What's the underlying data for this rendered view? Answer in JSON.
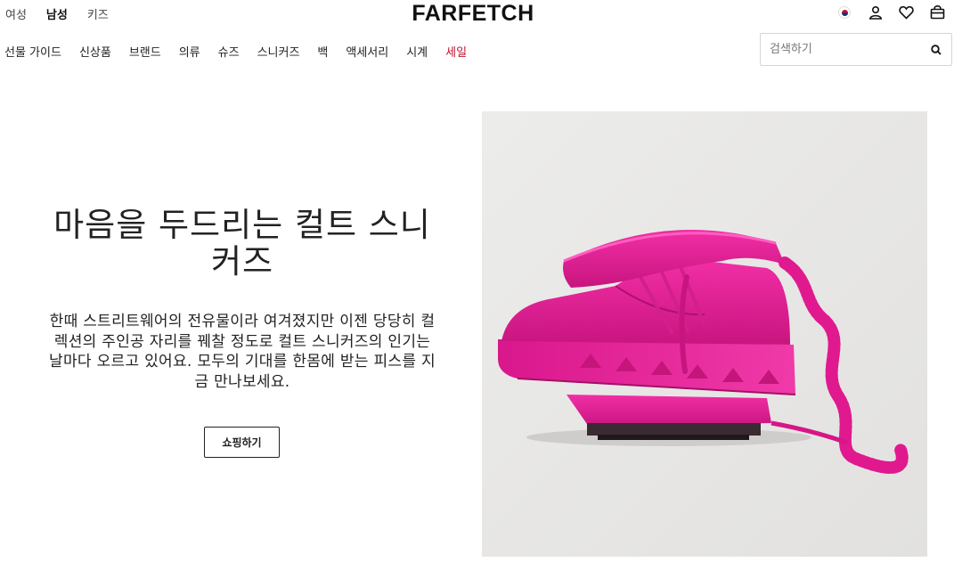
{
  "header": {
    "gender_tabs": [
      {
        "label": "여성",
        "active": false
      },
      {
        "label": "남성",
        "active": true
      },
      {
        "label": "키즈",
        "active": false
      }
    ],
    "logo": "FARFETCH",
    "icons": [
      "korea-flag-icon",
      "account-icon",
      "wishlist-heart-icon",
      "shopping-bag-icon"
    ]
  },
  "nav": {
    "items": [
      "선물 가이드",
      "신상품",
      "브랜드",
      "의류",
      "슈즈",
      "스니커즈",
      "백",
      "액세서리",
      "시계",
      "세일"
    ],
    "sale_color": "#c4122f"
  },
  "search": {
    "placeholder": "검색하기",
    "value": ""
  },
  "hero": {
    "title": "마음을 두드리는 컬트 스니커즈",
    "description": "한때 스트리트웨어의 전유물이라 여겨졌지만 이젠 당당히 컬렉션의 주인공 자리를 꿰찰 정도로 컬트 스니커즈의 인기는 날마다 오르고 있어요. 모두의 기대를 한몸에 받는 피스를 지금 만나보세요.",
    "cta_label": "쇼핑하기",
    "image_subject": "pink sneaker on pink telephone",
    "accent_color": "#e0198f"
  }
}
